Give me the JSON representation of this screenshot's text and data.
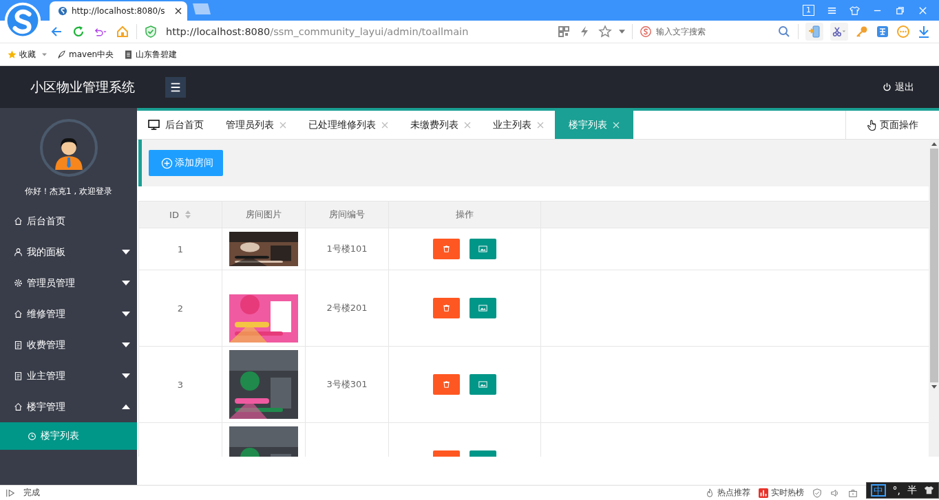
{
  "browser": {
    "tab_title": "http://localhost:8080/s",
    "url_host": "http://localhost:8080",
    "url_path": "/ssm_community_layui/admin/toallmain",
    "window_count": "1",
    "search_placeholder": "输入文字搜索",
    "bookmarks": [
      {
        "label": "收藏",
        "kind": "star"
      },
      {
        "label": "maven中央",
        "kind": "maven"
      },
      {
        "label": "山东鲁碧建",
        "kind": "page"
      }
    ]
  },
  "header": {
    "title": "小区物业管理系统",
    "logout": "退出"
  },
  "sidebar": {
    "greeting": "你好！杰克1 , 欢迎登录",
    "items": [
      {
        "label": "后台首页"
      },
      {
        "label": "我的面板",
        "expanded": false
      },
      {
        "label": "管理员管理",
        "expanded": false
      },
      {
        "label": "维修管理",
        "expanded": false
      },
      {
        "label": "收费管理",
        "expanded": false
      },
      {
        "label": "业主管理",
        "expanded": false
      },
      {
        "label": "楼宇管理",
        "expanded": true,
        "children": [
          {
            "label": "楼宇列表",
            "selected": true
          }
        ]
      }
    ]
  },
  "tabs": [
    {
      "label": "后台首页",
      "closable": false,
      "selected": false
    },
    {
      "label": "管理员列表",
      "closable": true,
      "selected": false
    },
    {
      "label": "已处理维修列表",
      "closable": true,
      "selected": false
    },
    {
      "label": "未缴费列表",
      "closable": true,
      "selected": false
    },
    {
      "label": "业主列表",
      "closable": true,
      "selected": false
    },
    {
      "label": "楼宇列表",
      "closable": true,
      "selected": true
    }
  ],
  "page_ops": "页面操作",
  "add_button": "添加房间",
  "table": {
    "columns": [
      "ID",
      "房间图片",
      "房间编号",
      "操作"
    ],
    "rows": [
      {
        "id": "1",
        "number": "1号楼101",
        "picture": {
          "kind": "picture"
        }
      },
      {
        "id": "2",
        "number": "2号楼201",
        "picture": {
          "kind": "picture"
        }
      },
      {
        "id": "3",
        "number": "3号楼301",
        "picture": {
          "kind": "picture"
        }
      },
      {
        "picture": {
          "kind": "picture"
        }
      }
    ]
  },
  "status_bar": {
    "text": "完成",
    "hot": "热点推荐",
    "trending": "实时热榜"
  },
  "ime": {
    "mode": "中",
    "punct": "°,",
    "width": "半"
  }
}
